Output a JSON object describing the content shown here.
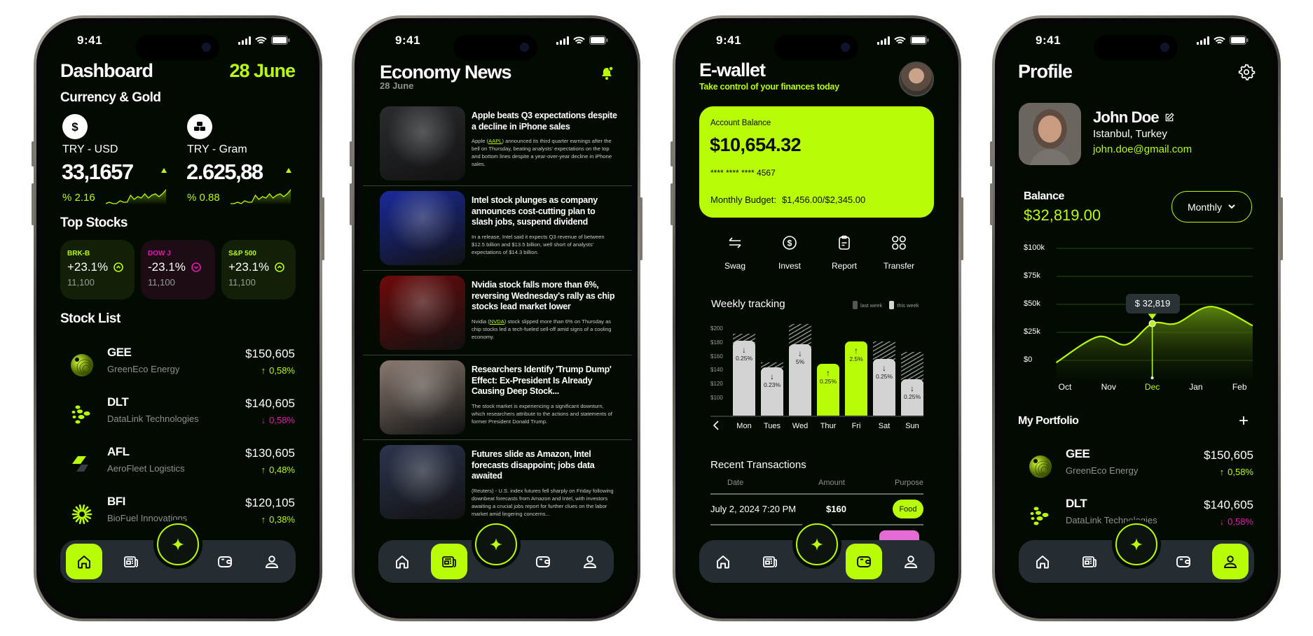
{
  "status": {
    "time": "9:41"
  },
  "colors": {
    "accent": "#b8fc08",
    "negative": "#e619b0",
    "screen_bg": "#020a02",
    "nav_bg": "#252d33"
  },
  "nav": {
    "items": [
      "home-icon",
      "news-icon",
      "sparkle-icon",
      "wallet-icon",
      "user-icon"
    ]
  },
  "dashboard": {
    "title": "Dashboard",
    "date": "28 June",
    "currency_title": "Currency & Gold",
    "currency": [
      {
        "icon": "dollar-icon",
        "pair": "TRY - USD",
        "value": "33,1657",
        "change": "% 2.16",
        "trend": "up",
        "spark": [
          2,
          3,
          2,
          2,
          4,
          3,
          3,
          8,
          5,
          7,
          6,
          9,
          6,
          8,
          9,
          7,
          9,
          12
        ]
      },
      {
        "icon": "gold-bars-icon",
        "pair": "TRY - Gram",
        "value": "2.625,88",
        "change": "% 0.88",
        "trend": "up",
        "spark": [
          2,
          2,
          3,
          2,
          4,
          3,
          3,
          8,
          5,
          7,
          6,
          9,
          6,
          8,
          9,
          7,
          9,
          12
        ]
      }
    ],
    "top_stocks_title": "Top Stocks",
    "top_stocks": [
      {
        "symbol": "BRK-B",
        "change": "+23.1%",
        "value": "11,100",
        "trend": "up"
      },
      {
        "symbol": "DOW J",
        "change": "-23.1%",
        "value": "11,100",
        "trend": "down"
      },
      {
        "symbol": "S&P 500",
        "change": "+23.1%",
        "value": "11,100",
        "trend": "up"
      }
    ],
    "stock_list_title": "Stock List",
    "stocks": [
      {
        "ticker": "GEE",
        "name": "GreenEco Energy",
        "price": "$150,605",
        "arrow": "↑",
        "change": "0,58%",
        "trend": "up",
        "logo": "sphere"
      },
      {
        "ticker": "DLT",
        "name": "DataLink Technologies",
        "price": "$140,605",
        "arrow": "↓",
        "change": "0,58%",
        "trend": "down",
        "logo": "dots"
      },
      {
        "ticker": "AFL",
        "name": "AeroFleet Logistics",
        "price": "$130,605",
        "arrow": "↑",
        "change": "0,48%",
        "trend": "up",
        "logo": "wing"
      },
      {
        "ticker": "BFI",
        "name": "BioFuel Innovations",
        "price": "$120,105",
        "arrow": "↑",
        "change": "0,38%",
        "trend": "up",
        "logo": "sun"
      }
    ]
  },
  "news": {
    "title": "Economy News",
    "date": "28 June",
    "items": [
      {
        "headline": "Apple beats Q3 expectations despite a decline in iPhone sales",
        "pre": "Apple (",
        "ticker": "AAPL",
        "post": ") announced its third quarter earnings after the bell on Thursday, beating analysts' expectations on the top and bottom lines despite a year-over-year decline in iPhone sales.",
        "image": "#2a2c30"
      },
      {
        "headline": "Intel stock plunges as company announces cost-cutting plan to slash jobs, suspend dividend",
        "pre": "In a release, Intel said it expects Q3 revenue of between $12.5 billion and $13.5 billion, well short of analysts' expectations of $14.3 billion.",
        "ticker": "",
        "post": "",
        "image": "#1a2a9a"
      },
      {
        "headline": "Nvidia stock falls more than 6%, reversing Wednesday's rally as chip stocks lead market lower",
        "pre": "Nvidia (",
        "ticker": "NVDA",
        "post": ") stock slipped more than 6% on Thursday as chip stocks led a tech-fueled sell-off amid signs of a cooling economy.",
        "image": "#6e0a0a"
      },
      {
        "headline": "Researchers Identify 'Trump Dump' Effect: Ex-President Is Already Causing Deep Stock...",
        "pre": "The stock market is experiencing a significant downturn, which researchers attribute to the actions and statements of former President Donald Trump.",
        "ticker": "",
        "post": "",
        "image": "#8a7a70"
      },
      {
        "headline": "Futures slide as Amazon, Intel forecasts disappoint; jobs data awaited",
        "pre": "(Reuters) - U.S. index futures fell sharply on Friday following downbeat forecasts from Amazon and Intel, with investors awaiting a crucial jobs report for further clues on the labor market amid lingering concerns...",
        "ticker": "",
        "post": "",
        "image": "#2c3550"
      }
    ]
  },
  "wallet": {
    "title": "E-wallet",
    "subtitle": "Take control of your finances today",
    "balance_label": "Account Balance",
    "balance": "$10,654.32",
    "card_number": "**** **** **** 4567",
    "budget_label": "Monthly Budget:",
    "budget_value": "$1,456.00/$2,345.00",
    "actions": [
      {
        "label": "Swag",
        "icon": "swap-icon"
      },
      {
        "label": "Invest",
        "icon": "dollar-circle-icon"
      },
      {
        "label": "Report",
        "icon": "clipboard-icon"
      },
      {
        "label": "Transfer",
        "icon": "grid-icon"
      }
    ],
    "weekly": {
      "title": "Weekly tracking",
      "legend": [
        "last week",
        "this week"
      ],
      "y_ticks": [
        "$200",
        "$180",
        "$160",
        "$140",
        "$120",
        "$100"
      ],
      "y_tick_values": [
        200,
        180,
        160,
        140,
        120,
        100
      ],
      "ylim": [
        75,
        210
      ],
      "days": [
        "Mon",
        "Tues",
        "Wed",
        "Thur",
        "Fri",
        "Sat",
        "Sun"
      ],
      "this_week": [
        183,
        144,
        178,
        150,
        182,
        157,
        127
      ],
      "last_week": [
        193,
        152,
        207,
        null,
        null,
        182,
        167
      ],
      "changes": [
        "0.25%",
        "0.23%",
        "5%",
        "0.25%",
        "2.5%",
        "0.25%",
        "0.25%"
      ],
      "directions": [
        "down",
        "down",
        "down",
        "up",
        "up",
        "down",
        "down"
      ]
    },
    "transactions_title": "Recent Transactions",
    "columns": [
      "Date",
      "Amount",
      "Purpose"
    ],
    "transactions": [
      {
        "date": "July 2, 2024 7:20 PM",
        "amount": "$160",
        "purpose": "Food"
      }
    ]
  },
  "profile": {
    "title": "Profile",
    "name": "John Doe",
    "location": "Istanbul, Turkey",
    "email": "john.doe@gmail.com",
    "balance_label": "Balance",
    "balance": "$32,819.00",
    "period": "Monthly",
    "chart": {
      "type": "area",
      "y_ticks": [
        "$100k",
        "$75k",
        "$50k",
        "$25k",
        "$0"
      ],
      "y_tick_values": [
        100,
        75,
        50,
        25,
        0
      ],
      "x_ticks": [
        "Oct",
        "Nov",
        "Dec",
        "Jan",
        "Feb"
      ],
      "highlight_index": 2,
      "tooltip": "$ 32,819",
      "points": [
        [
          -0.2,
          -2
        ],
        [
          0.75,
          21
        ],
        [
          1.4,
          14
        ],
        [
          2,
          32.8
        ],
        [
          2.55,
          33
        ],
        [
          3.35,
          48
        ],
        [
          4.3,
          31
        ]
      ]
    },
    "portfolio_title": "My Portfolio",
    "portfolio": [
      {
        "ticker": "GEE",
        "name": "GreenEco Energy",
        "price": "$150,605",
        "arrow": "↑",
        "change": "0,58%",
        "trend": "up",
        "logo": "sphere"
      },
      {
        "ticker": "DLT",
        "name": "DataLink Technologies",
        "price": "$140,605",
        "arrow": "↓",
        "change": "0,58%",
        "trend": "down",
        "logo": "dots"
      }
    ]
  }
}
